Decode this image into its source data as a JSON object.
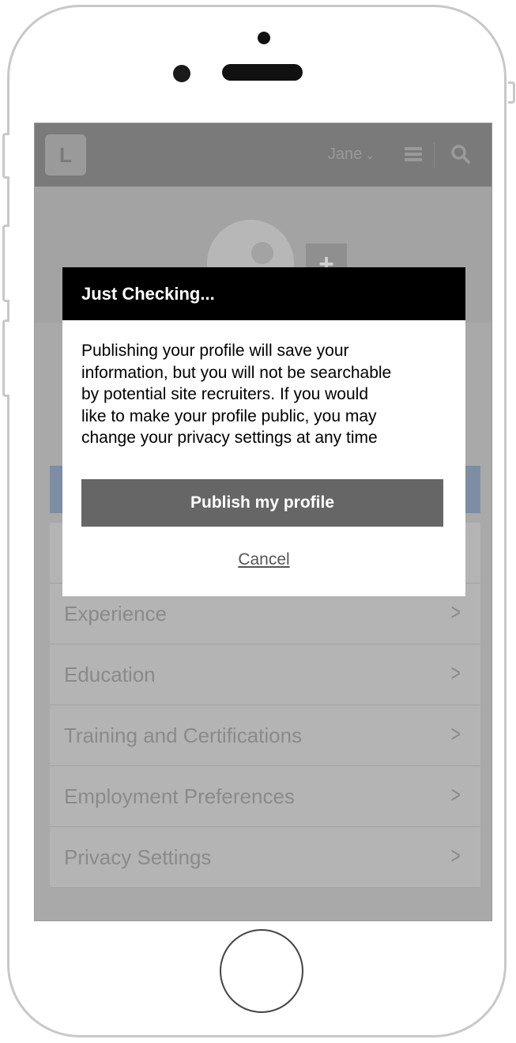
{
  "header": {
    "logo_letter": "L",
    "user_name": "Jane",
    "user_chevron": "⌄"
  },
  "profile": {
    "add_photo_symbol": "+"
  },
  "sections": [
    {
      "label": "Experience",
      "arrow": ">"
    },
    {
      "label": "Education",
      "arrow": ">"
    },
    {
      "label": "Training and Certifications",
      "arrow": ">"
    },
    {
      "label": "Employment Preferences",
      "arrow": ">"
    },
    {
      "label": "Privacy Settings",
      "arrow": ">"
    }
  ],
  "dialog": {
    "title": "Just Checking...",
    "lines": [
      "Publishing your profile will save your",
      "information, but you will not be searchable",
      "by potential site recruiters. If you would",
      "like to make your profile public, you may",
      "change your privacy settings at any time"
    ],
    "publish_label": "Publish my profile",
    "cancel_label": "Cancel"
  },
  "icons": {
    "menu": "hamburger-icon",
    "search": "search-icon",
    "avatar": "user-silhouette-icon"
  },
  "colors": {
    "overlay_gray": "#a9a9a9",
    "dialog_header": "#000000",
    "publish_button": "#666666",
    "accent_strip": "#7d8da3"
  }
}
